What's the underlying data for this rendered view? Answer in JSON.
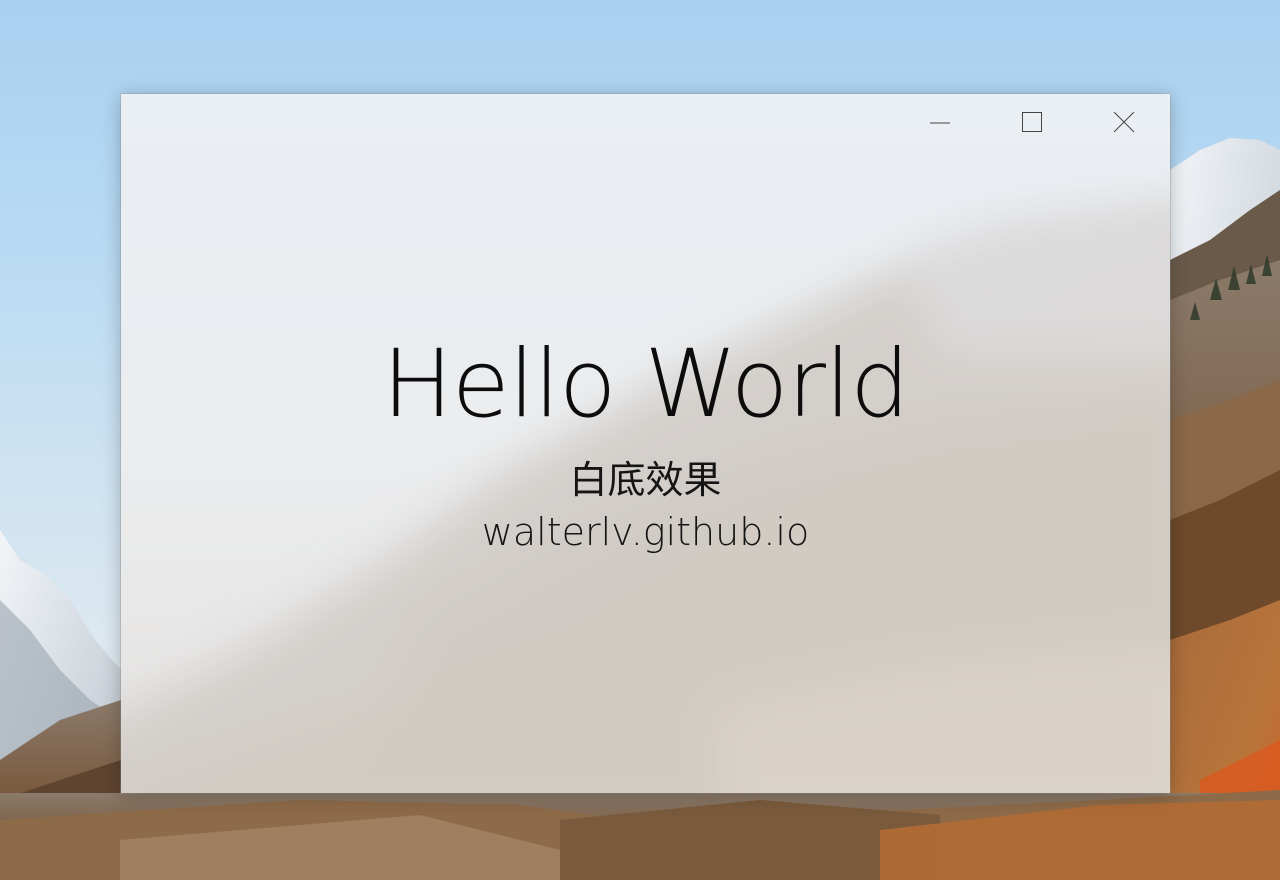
{
  "window": {
    "heading": "Hello World",
    "subtitle": "白底效果",
    "url": "walterlv.github.io"
  },
  "caption_buttons": {
    "minimize_icon": "minimize-icon",
    "maximize_icon": "maximize-icon",
    "close_icon": "close-icon"
  },
  "colors": {
    "sky": "#b7d9f3",
    "snow": "#e9edf1",
    "rock": "#8a6f55",
    "autumn": "#c06a2a",
    "acrylic_tint": "#f2f2f2",
    "text": "#0c0c0c"
  }
}
